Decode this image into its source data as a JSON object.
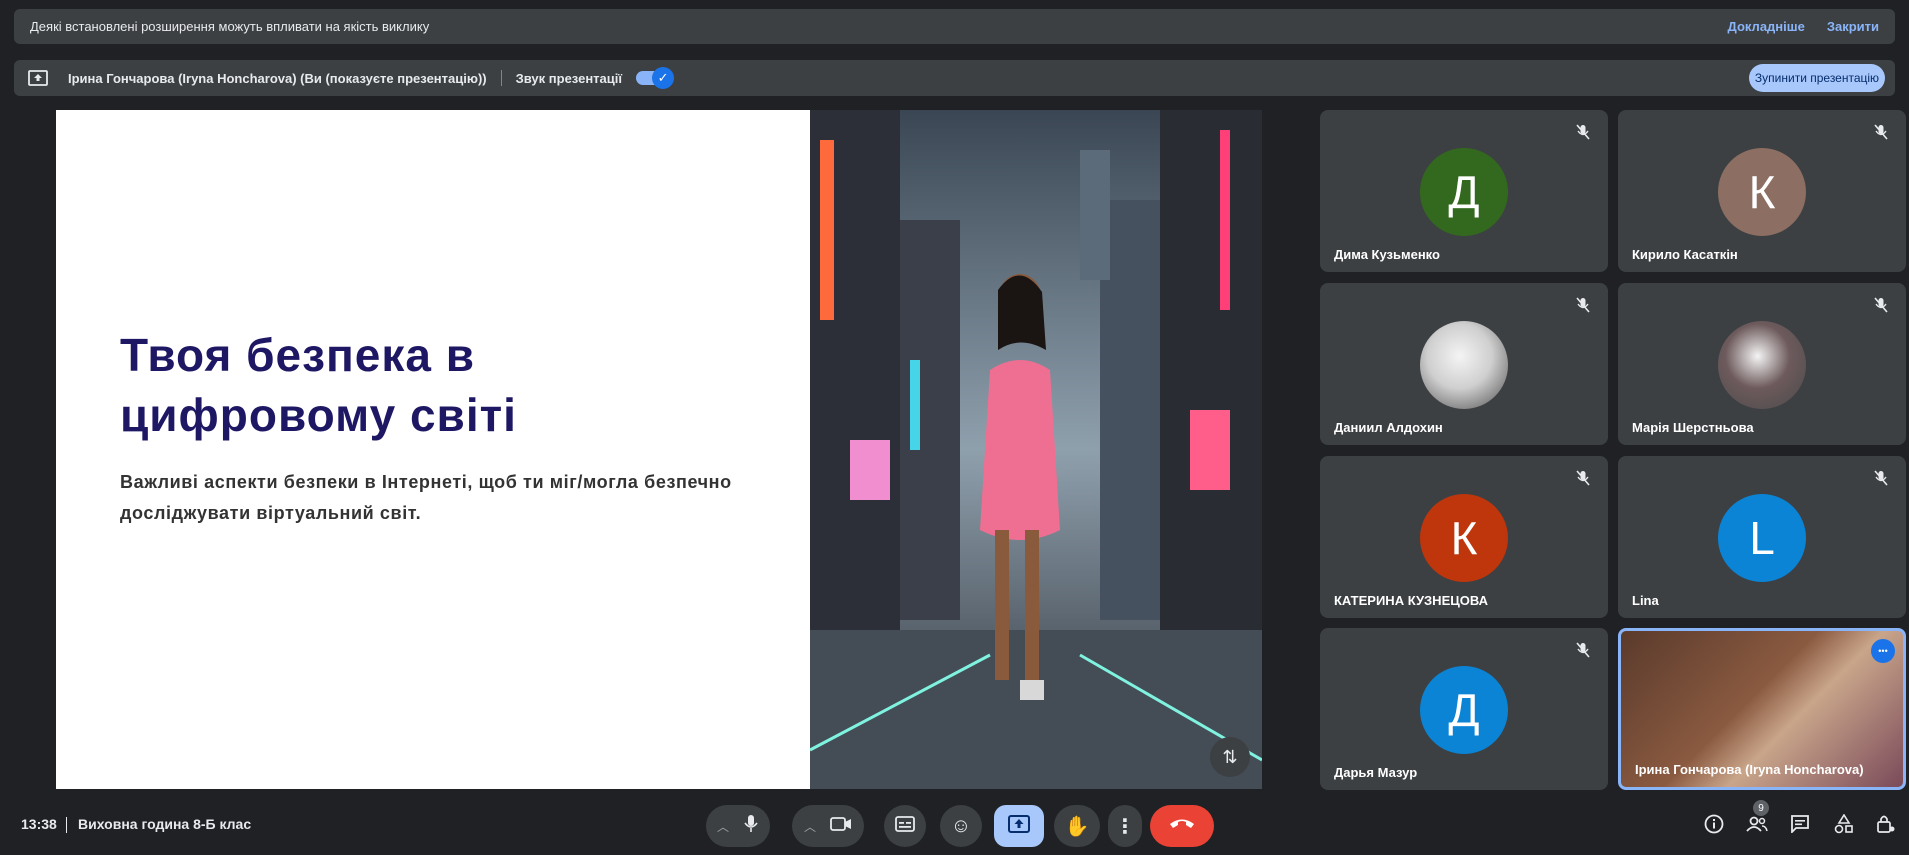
{
  "warning_bar": {
    "text": "Деякі встановлені розширення можуть впливати на якість виклику",
    "details_link": "Докладніше",
    "close_link": "Закрити"
  },
  "presentation_bar": {
    "presenter": "Ірина Гончарова (Iryna Honcharova) (Ви (показуєте презентацію))",
    "sound_label": "Звук презентації",
    "sound_on": true,
    "stop_button": "Зупинити презентацію"
  },
  "slide": {
    "title": "Твоя безпека в цифровому світі",
    "subtitle": "Важливі аспекти безпеки в Інтернеті, щоб ти міг/могла безпечно досліджувати віртуальний світ."
  },
  "participants": [
    {
      "name": "Дима Кузьменко",
      "initial": "Д",
      "color": "#33691e",
      "muted": true
    },
    {
      "name": "Кирило Касаткін",
      "initial": "К",
      "color": "#8d6e63",
      "muted": true
    },
    {
      "name": "Даниил Алдохин",
      "initial": "",
      "color": "#cfcfcf",
      "muted": true
    },
    {
      "name": "Марія Шерстньова",
      "initial": "",
      "color": "#6d5a5c",
      "muted": true
    },
    {
      "name": "КАТЕРИНА КУЗНЕЦОВА",
      "initial": "К",
      "color": "#bf360c",
      "muted": true
    },
    {
      "name": "Lina",
      "initial": "L",
      "color": "#0b84d6",
      "muted": true
    },
    {
      "name": "Дарья Мазур",
      "initial": "Д",
      "color": "#0b84d6",
      "muted": true
    },
    {
      "name": "Ірина Гончарова (Iryna Honcharova)",
      "initial": "",
      "color": "#6b4a3b",
      "muted": false
    }
  ],
  "bottom_bar": {
    "time": "13:38",
    "meeting_title": "Виховна година 8-Б клас",
    "participant_count": "9"
  },
  "colors": {
    "background": "#202124",
    "bar": "#3c4043",
    "accent": "#8ab4f8",
    "end_call": "#ea4335",
    "slide_title": "#1e1763"
  }
}
